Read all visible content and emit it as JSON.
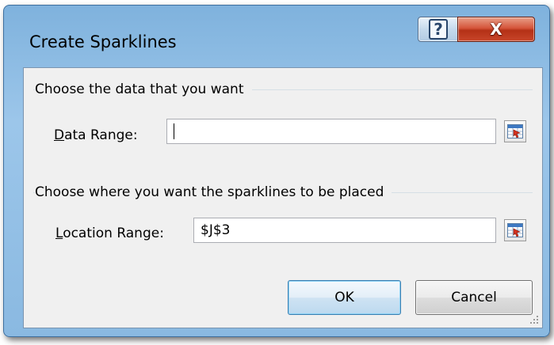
{
  "dialog": {
    "title": "Create Sparklines",
    "help_symbol": "?",
    "close_symbol": "X"
  },
  "data_section": {
    "heading": "Choose the data that you want",
    "field_accesskey": "D",
    "field_label_rest": "ata Range:",
    "value": ""
  },
  "location_section": {
    "heading": "Choose where you want the sparklines to be placed",
    "field_accesskey": "L",
    "field_label_rest": "ocation Range:",
    "value": "$J$3"
  },
  "buttons": {
    "ok": "OK",
    "cancel": "Cancel"
  },
  "colors": {
    "frame": "#9cc6ea",
    "close_button": "#c8452a",
    "ok_border": "#3c7fb1"
  },
  "icons": {
    "help": "help-icon",
    "close": "close-icon",
    "range_selector": "collapse-dialog-icon",
    "resize": "resize-grip-icon"
  }
}
